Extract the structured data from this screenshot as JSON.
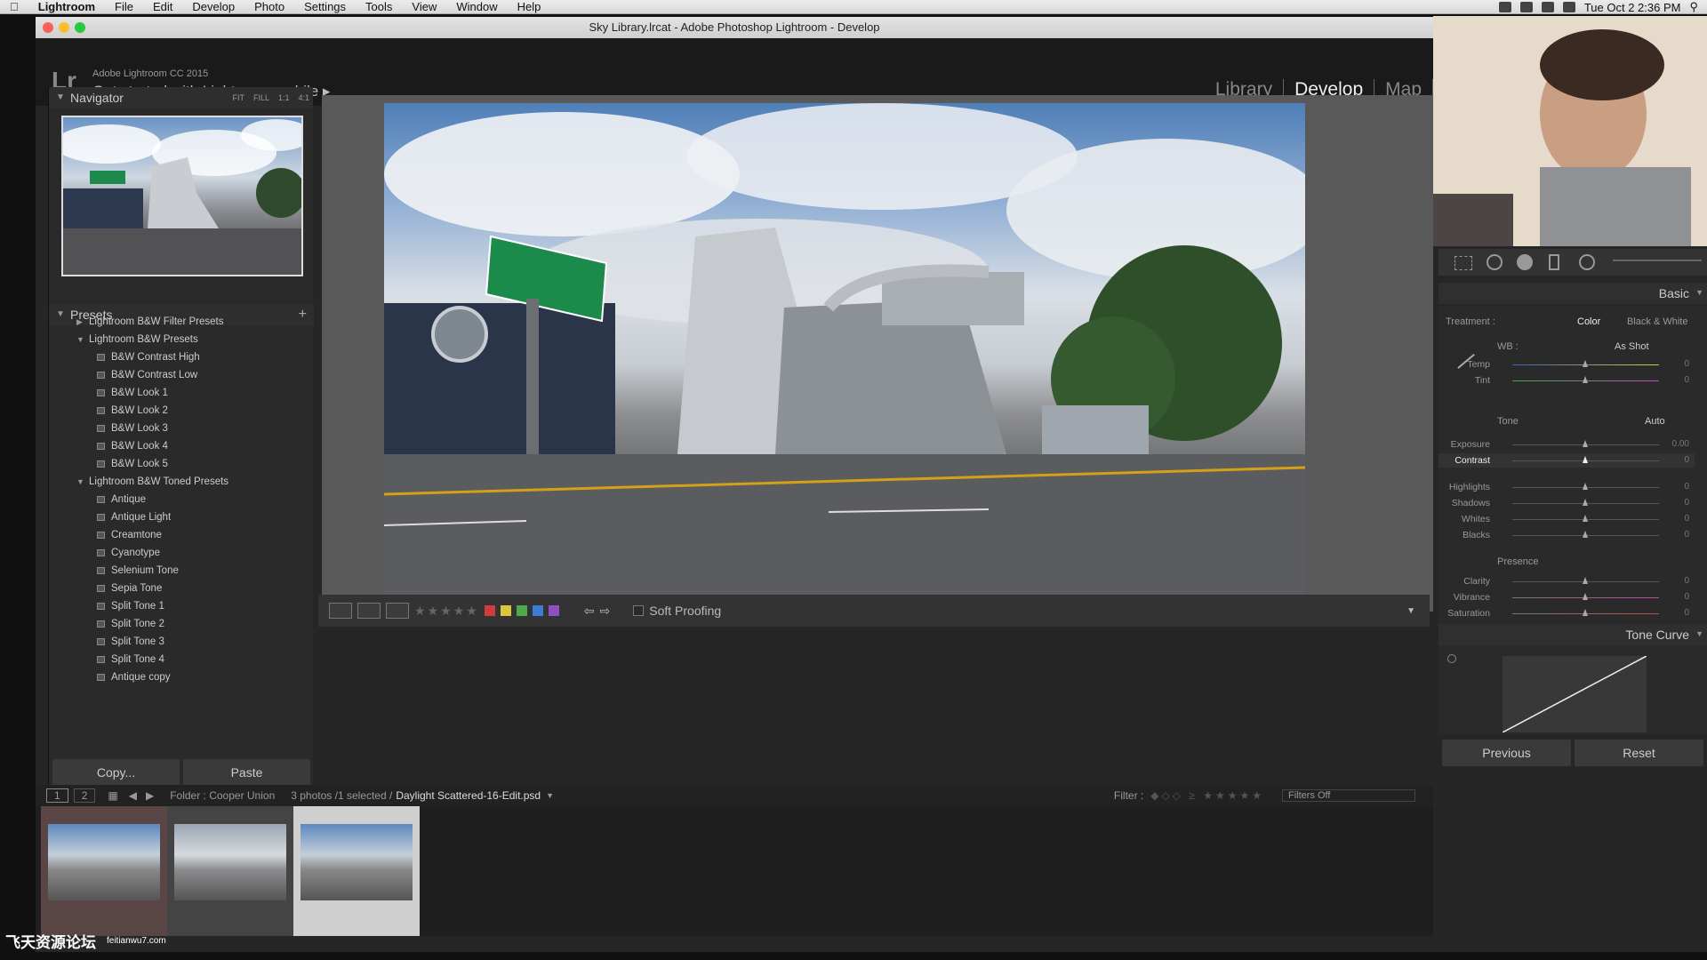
{
  "menubar": {
    "app": "Lightroom",
    "items": [
      "File",
      "Edit",
      "Develop",
      "Photo",
      "Settings",
      "Tools",
      "View",
      "Window",
      "Help"
    ],
    "clock": "Tue Oct 2  2:36 PM"
  },
  "window": {
    "title": "Sky Library.lrcat - Adobe Photoshop Lightroom - Develop"
  },
  "identity": {
    "logo": "Lr",
    "version": "Adobe Lightroom CC 2015",
    "mobile": "Get started with Lightroom mobile  ▸"
  },
  "modules": [
    "Library",
    "Develop",
    "Map"
  ],
  "navigator": {
    "title": "Navigator",
    "options": [
      "FIT",
      "FILL",
      "1:1",
      "4:1"
    ]
  },
  "presets": {
    "title": "Presets",
    "add": "+",
    "folders": [
      {
        "name": "Lightroom B&W Filter Presets",
        "open": false,
        "items": []
      },
      {
        "name": "Lightroom B&W Presets",
        "open": true,
        "items": [
          "B&W Contrast High",
          "B&W Contrast Low",
          "B&W Look 1",
          "B&W Look 2",
          "B&W Look 3",
          "B&W Look 4",
          "B&W Look 5"
        ]
      },
      {
        "name": "Lightroom B&W Toned Presets",
        "open": true,
        "items": [
          "Antique",
          "Antique Light",
          "Creamtone",
          "Cyanotype",
          "Selenium Tone",
          "Sepia Tone",
          "Split Tone 1",
          "Split Tone 2",
          "Split Tone 3",
          "Split Tone 4",
          "Antique copy"
        ]
      }
    ]
  },
  "leftbuttons": {
    "copy": "Copy...",
    "paste": "Paste"
  },
  "toolbar": {
    "soft_proofing": "Soft Proofing",
    "stars": "★★★★★",
    "colors": [
      "#d23b3b",
      "#d8c83a",
      "#4cab4c",
      "#3d7bd6",
      "#8e4ec4"
    ]
  },
  "basic": {
    "title": "Basic",
    "treatment_label": "Treatment :",
    "color": "Color",
    "bw": "Black & White",
    "wb_label": "WB :",
    "wb_value": "As Shot",
    "tone": "Tone",
    "auto": "Auto",
    "presence": "Presence",
    "sliders": [
      {
        "label": "Temp",
        "value": "0"
      },
      {
        "label": "Tint",
        "value": "0"
      },
      {
        "label": "Exposure",
        "value": "0.00"
      },
      {
        "label": "Contrast",
        "value": "0"
      },
      {
        "label": "Highlights",
        "value": "0"
      },
      {
        "label": "Shadows",
        "value": "0"
      },
      {
        "label": "Whites",
        "value": "0"
      },
      {
        "label": "Blacks",
        "value": "0"
      },
      {
        "label": "Clarity",
        "value": "0"
      },
      {
        "label": "Vibrance",
        "value": "0"
      },
      {
        "label": "Saturation",
        "value": "0"
      }
    ]
  },
  "tonecurve": {
    "title": "Tone Curve"
  },
  "rightbuttons": {
    "previous": "Previous",
    "reset": "Reset"
  },
  "filmbar": {
    "view1": "1",
    "view2": "2",
    "folder": "Folder : Cooper Union",
    "count": "3 photos /1 selected /",
    "filename": "Daylight Scattered-16-Edit.psd",
    "filter_label": "Filter :",
    "filters_off": "Filters Off"
  },
  "watermark": {
    "text1": "飞天资源论坛",
    "text2": "feitianwu7.com"
  }
}
